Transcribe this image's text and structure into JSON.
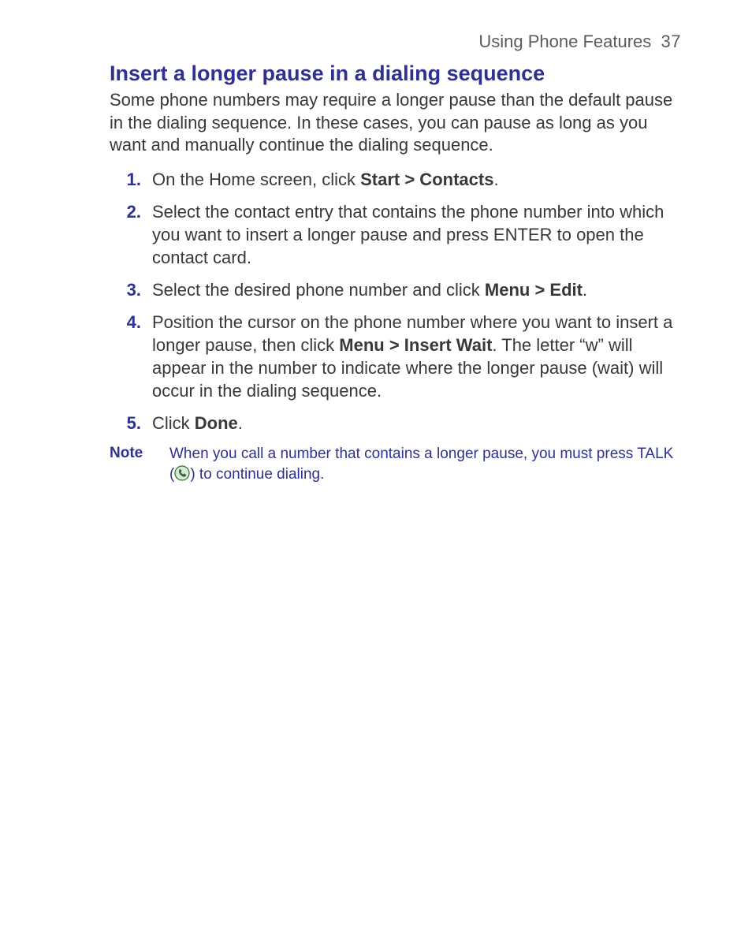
{
  "header": {
    "section": "Using Phone Features",
    "page": "37"
  },
  "title": "Insert a longer pause in a dialing sequence",
  "intro": "Some phone numbers may require a longer pause than the default pause in the dialing sequence. In these cases, you can pause as long as you want and manually continue the dialing sequence.",
  "steps": [
    {
      "num": "1.",
      "pre": "On the Home screen, click ",
      "bold1": "Start > Contacts",
      "post": "."
    },
    {
      "num": "2.",
      "pre": "Select the contact entry that contains the phone number into which you want to insert a longer pause and press ENTER to open the contact card.",
      "bold1": "",
      "post": ""
    },
    {
      "num": "3.",
      "pre": "Select the desired phone number and click ",
      "bold1": "Menu > Edit",
      "post": "."
    },
    {
      "num": "4.",
      "pre": "Position the cursor on the phone number where you want to insert a longer pause, then click ",
      "bold1": "Menu > Insert Wait",
      "post": ". The letter “w” will appear in the number to indicate where the longer pause (wait) will occur in the dialing sequence."
    },
    {
      "num": "5.",
      "pre": "Click ",
      "bold1": "Done",
      "post": "."
    }
  ],
  "note": {
    "label": "Note",
    "text_pre": "When you call a number that contains a longer pause, you must press TALK ",
    "paren_open": "(",
    "paren_close": ")",
    "text_post": " to continue dialing."
  }
}
